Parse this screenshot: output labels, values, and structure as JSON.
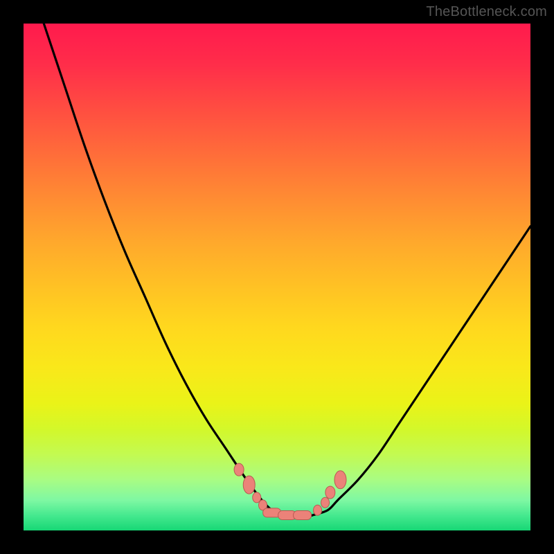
{
  "attribution": "TheBottleneck.com",
  "colors": {
    "frame": "#000000",
    "gradient_top": "#ff1a4d",
    "gradient_bottom": "#17d775",
    "curve_stroke": "#000000",
    "marker_fill": "#eb8279",
    "marker_stroke": "#b85a52"
  },
  "chart_data": {
    "type": "line",
    "title": "",
    "xlabel": "",
    "ylabel": "",
    "xlim": [
      0,
      100
    ],
    "ylim": [
      0,
      100
    ],
    "axes_visible": false,
    "grid": false,
    "series": [
      {
        "name": "bottleneck-curve",
        "x": [
          4,
          8,
          12,
          16,
          20,
          24,
          28,
          32,
          36,
          40,
          44,
          47,
          49,
          51,
          53,
          55,
          57,
          60,
          62,
          66,
          70,
          74,
          78,
          82,
          86,
          90,
          94,
          98,
          100
        ],
        "y": [
          100,
          88,
          76,
          65,
          55,
          46,
          37,
          29,
          22,
          16,
          10,
          6,
          4,
          3,
          2.5,
          2.5,
          3,
          4,
          6,
          10,
          15,
          21,
          27,
          33,
          39,
          45,
          51,
          57,
          60
        ]
      }
    ],
    "markers": [
      {
        "x": 42.5,
        "y": 12,
        "shape": "ellipse"
      },
      {
        "x": 44.5,
        "y": 9,
        "shape": "large-ellipse"
      },
      {
        "x": 46.0,
        "y": 6.5,
        "shape": "small"
      },
      {
        "x": 47.2,
        "y": 5,
        "shape": "small"
      },
      {
        "x": 49.0,
        "y": 3.5,
        "shape": "bar"
      },
      {
        "x": 52.0,
        "y": 3,
        "shape": "bar"
      },
      {
        "x": 55.0,
        "y": 3,
        "shape": "bar"
      },
      {
        "x": 58.0,
        "y": 4,
        "shape": "small"
      },
      {
        "x": 59.5,
        "y": 5.5,
        "shape": "small"
      },
      {
        "x": 60.5,
        "y": 7.5,
        "shape": "ellipse"
      },
      {
        "x": 62.5,
        "y": 10,
        "shape": "large-ellipse"
      }
    ]
  }
}
